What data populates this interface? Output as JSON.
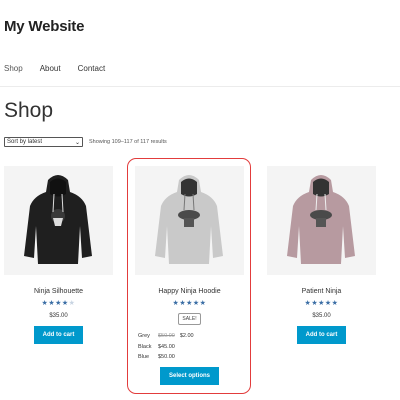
{
  "site": {
    "title": "My Website"
  },
  "nav": {
    "items": [
      "Shop",
      "About",
      "Contact"
    ]
  },
  "page": {
    "title": "Shop"
  },
  "toolbar": {
    "sort_selected": "Sort by latest",
    "result_count": "Showing 109–117 of 117 results"
  },
  "products": [
    {
      "name": "Ninja Silhouette",
      "rating": 4,
      "rating_max": 5,
      "price": "$35.00",
      "button": "Add to cart",
      "hoodie_color": "#1f1f1f",
      "icon": "ninja-silhouette-hoodie-image"
    },
    {
      "name": "Happy Ninja Hoodie",
      "rating": 5,
      "rating_max": 5,
      "badge": "SALE!",
      "variants": [
        {
          "name": "Grey",
          "old_price": "$50.00",
          "price": "$2.00"
        },
        {
          "name": "Black",
          "price": "$45.00"
        },
        {
          "name": "Blue",
          "price": "$50.00"
        }
      ],
      "button": "Select options",
      "hoodie_color": "#c9c9c9",
      "icon": "happy-ninja-hoodie-image"
    },
    {
      "name": "Patient Ninja",
      "rating": 5,
      "rating_max": 5,
      "price": "$35.00",
      "button": "Add to cart",
      "hoodie_color": "#b79aa0",
      "icon": "patient-ninja-hoodie-image"
    }
  ],
  "colors": {
    "accent_button": "#0099cc",
    "highlight": "#e23c3c",
    "star": "#3b6ea5"
  }
}
